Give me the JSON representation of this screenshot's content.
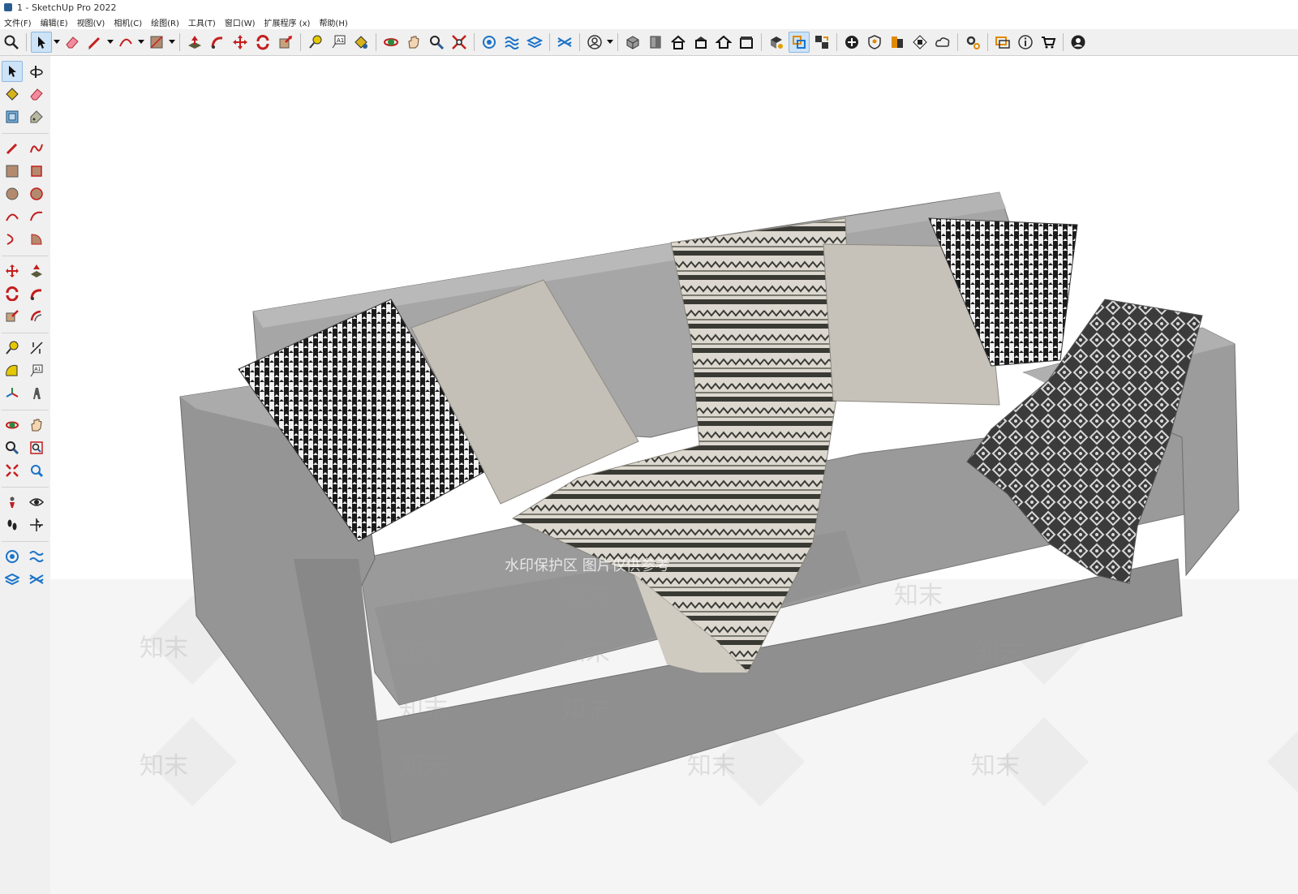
{
  "window": {
    "title": "1 - SketchUp Pro 2022"
  },
  "menu": [
    "文件(F)",
    "编辑(E)",
    "视图(V)",
    "相机(C)",
    "绘图(R)",
    "工具(T)",
    "窗口(W)",
    "扩展程序 (x)",
    "帮助(H)"
  ],
  "toolbar": {
    "icons": [
      "search-icon",
      "select-icon",
      "eraser-icon",
      "pencil-icon",
      "arc-icon",
      "rectangle-icon",
      "push-pull-icon",
      "follow-me-icon",
      "move-icon",
      "rotate-icon",
      "scale-icon",
      "tape-measure-icon",
      "text-icon",
      "paint-bucket-icon",
      "orbit-icon",
      "pan-icon",
      "zoom-icon",
      "zoom-extents-icon",
      "solid-tools-icon",
      "sandbox-icon",
      "layers-icon",
      "warehouse-icon",
      "user-icon",
      "iso-view-icon",
      "front-view-icon",
      "home-icon",
      "top-view-icon",
      "house-icon",
      "right-view-icon",
      "component-icon",
      "select-group-icon",
      "transfer-icon",
      "add-icon",
      "shield-icon",
      "styles-icon",
      "checker-icon",
      "cloud-icon",
      "settings-icon",
      "chat-icon",
      "info-icon",
      "cart-icon",
      "account-icon"
    ]
  },
  "sidebar": {
    "icons": [
      "select-icon",
      "orbit-icon",
      "paint-bucket-icon",
      "eraser-icon",
      "component-icon",
      "tag-icon",
      "pencil-icon",
      "freehand-icon",
      "rectangle-icon",
      "rotated-rectangle-icon",
      "circle-icon",
      "polygon-icon",
      "arc-icon",
      "two-point-arc-icon",
      "three-point-arc-icon",
      "pie-icon",
      "move-icon",
      "push-pull-icon",
      "rotate-icon",
      "follow-me-icon",
      "scale-icon",
      "offset-icon",
      "tape-measure-icon",
      "dimension-icon",
      "protractor-icon",
      "text-icon",
      "axes-icon",
      "3d-text-icon",
      "orbit-tool-icon",
      "pan-tool-icon",
      "zoom-tool-icon",
      "zoom-window-icon",
      "zoom-extents-tool-icon",
      "previous-view-icon",
      "position-camera-icon",
      "look-around-icon",
      "walk-icon",
      "section-plane-icon",
      "solid-outer-icon",
      "sandbox-smoove-icon",
      "sandbox-stamp-icon",
      "sandbox-drape-icon"
    ]
  },
  "viewport": {
    "watermark_text": "知末",
    "watermark_banner": "水印保护区 图片仅供参考"
  },
  "colors": {
    "accent": "#1a73c8",
    "toolbar_bg": "#f0f0f0",
    "active_bg": "#cde3f7",
    "sofa_fabric": "#8f8f8f"
  }
}
